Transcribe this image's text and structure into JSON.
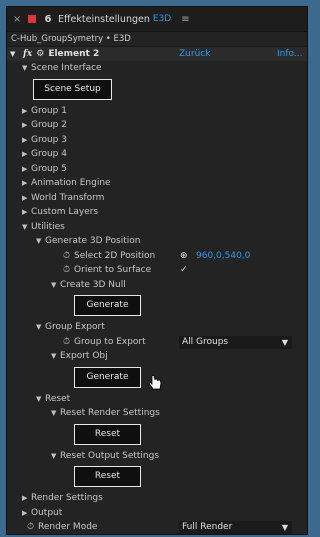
{
  "titlebar": {
    "close": "×",
    "lock": "6",
    "title": "Effekteinstellungen",
    "comp": "E3D",
    "menu": "≡"
  },
  "layer_path": "C-Hub_GroupSymetry • E3D",
  "effect": {
    "fx": "fx",
    "name": "Element 2",
    "back": "Zurück",
    "info": "Info..."
  },
  "scene_interface": {
    "label": "Scene Interface",
    "button": "Scene Setup"
  },
  "groups": [
    "Group 1",
    "Group 2",
    "Group 3",
    "Group 4",
    "Group 5",
    "Animation Engine",
    "World Transform",
    "Custom Layers"
  ],
  "utilities": {
    "label": "Utilities",
    "gen3d": {
      "label": "Generate 3D Position",
      "select_2d": "Select 2D Position",
      "select_2d_value": "960,0,540,0",
      "orient": "Orient to Surface",
      "orient_checked": "✓",
      "create_null": "Create 3D Null",
      "generate_btn": "Generate"
    },
    "group_export": {
      "label": "Group Export",
      "group_to_export": "Group to Export",
      "group_value": "All Groups",
      "export_obj": "Export Obj",
      "generate_btn": "Generate"
    },
    "reset": {
      "label": "Reset",
      "render_label": "Reset Render Settings",
      "render_btn": "Reset",
      "output_label": "Reset Output Settings",
      "output_btn": "Reset"
    }
  },
  "bottom": {
    "render_settings": "Render Settings",
    "output": "Output",
    "render_mode": "Render Mode",
    "render_mode_value": "Full Render"
  },
  "colors": {
    "accent": "#2f9be8",
    "red_swatch": "#d83a3a"
  }
}
